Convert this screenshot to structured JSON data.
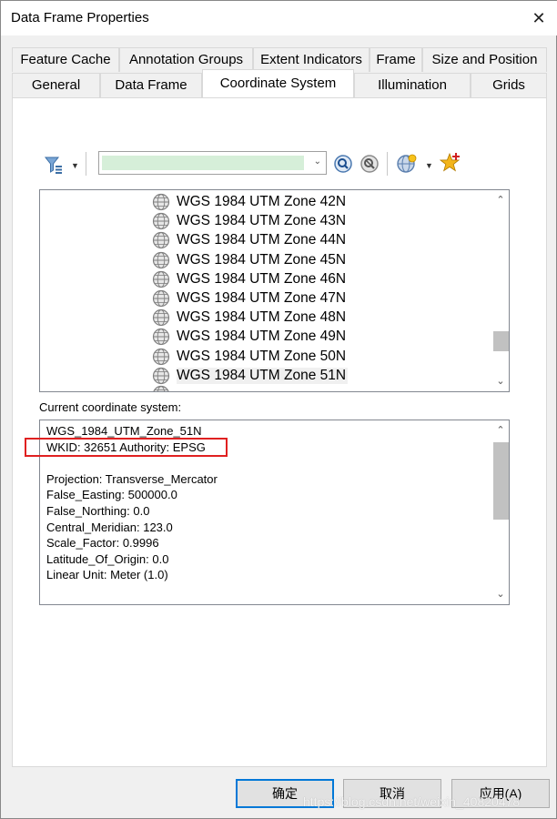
{
  "window": {
    "title": "Data Frame Properties",
    "close_label": "✕"
  },
  "tabs": {
    "row1": [
      "Feature Cache",
      "Annotation Groups",
      "Extent Indicators",
      "Frame",
      "Size and Position"
    ],
    "row2": [
      "General",
      "Data Frame",
      "Coordinate System",
      "Illumination",
      "Grids"
    ],
    "active": "Coordinate System"
  },
  "toolbar": {
    "filter_icon": "filter-icon",
    "search_value": "",
    "search_icon": "search-icon",
    "clear_search_icon": "clear-search-icon",
    "add_coordinate_system_icon": "globe-add-icon",
    "favorites_icon": "add-to-favorites-icon"
  },
  "coordinate_list": {
    "items": [
      "WGS 1984 UTM Zone 42N",
      "WGS 1984 UTM Zone 43N",
      "WGS 1984 UTM Zone 44N",
      "WGS 1984 UTM Zone 45N",
      "WGS 1984 UTM Zone 46N",
      "WGS 1984 UTM Zone 47N",
      "WGS 1984 UTM Zone 48N",
      "WGS 1984 UTM Zone 49N",
      "WGS 1984 UTM Zone 50N",
      "WGS 1984 UTM Zone 51N"
    ],
    "selected": "WGS 1984 UTM Zone 51N"
  },
  "current": {
    "label": "Current coordinate system:",
    "lines": [
      "WGS_1984_UTM_Zone_51N",
      "WKID: 32651 Authority: EPSG",
      "",
      "Projection: Transverse_Mercator",
      "False_Easting: 500000.0",
      "False_Northing: 0.0",
      "Central_Meridian: 123.0",
      "Scale_Factor: 0.9996",
      "Latitude_Of_Origin: 0.0",
      "Linear Unit: Meter (1.0)"
    ]
  },
  "buttons": {
    "ok": "确定",
    "cancel": "取消",
    "apply": "应用(A)"
  },
  "watermark": "https://blog.csdn.net/weixin_40820478",
  "colors": {
    "highlight": "#e02020",
    "default_button_border": "#0078d7"
  }
}
